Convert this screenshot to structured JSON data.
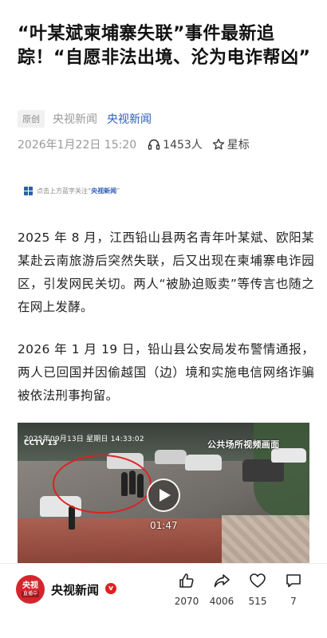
{
  "article": {
    "title": "“叶某斌柬埔寨失联”事件最新追踪！“自愿非法出境、沦为电诈帮凶”",
    "original_tag": "原创",
    "outlet_gray": "央视新闻",
    "outlet_link": "央视新闻",
    "date": "2026年1月22日 15:20",
    "listen_count": "1453人",
    "star_label": "星标",
    "banner_prefix": "点击上方蓝字关注“",
    "banner_brand": "央视新闻",
    "banner_suffix": "”",
    "paragraph_1": "2025 年 8 月，江西铅山县两名青年叶某斌、欧阳某某赴云南旅游后突然失联，后又出现在柬埔寨电诈园区，引发网民关切。两人“被胁迫贩卖”等传言也随之在网上发酵。",
    "paragraph_2": "2026 年 1 月 19 日，铅山县公安局发布警情通报，两人已回国并因偷越国（边）境和实施电信网络诈骗被依法刑事拘留。"
  },
  "video": {
    "timestamp_overlay": "2025年09月13日 星期日 14:33:02",
    "source_overlay": "CCTV 13",
    "caption_overlay": "公共场所视频画面",
    "duration": "01:47"
  },
  "bottom_bar": {
    "avatar_logo": "央视",
    "avatar_live": "直播中",
    "account_name": "央视新闻",
    "verified_mark": "v",
    "like_count": "2070",
    "share_count": "4006",
    "favorite_count": "515",
    "comment_count": "7"
  },
  "colors": {
    "accent_blue": "#2d5fb8",
    "brand_red": "#d3262c",
    "highlight_circle": "#e02020"
  },
  "icons": {
    "listen": "headphones-icon",
    "star": "star-icon",
    "play": "play-icon",
    "like": "thumbs-up-icon",
    "share": "share-arrow-icon",
    "favorite": "heart-icon",
    "comment": "comment-bubble-icon"
  }
}
